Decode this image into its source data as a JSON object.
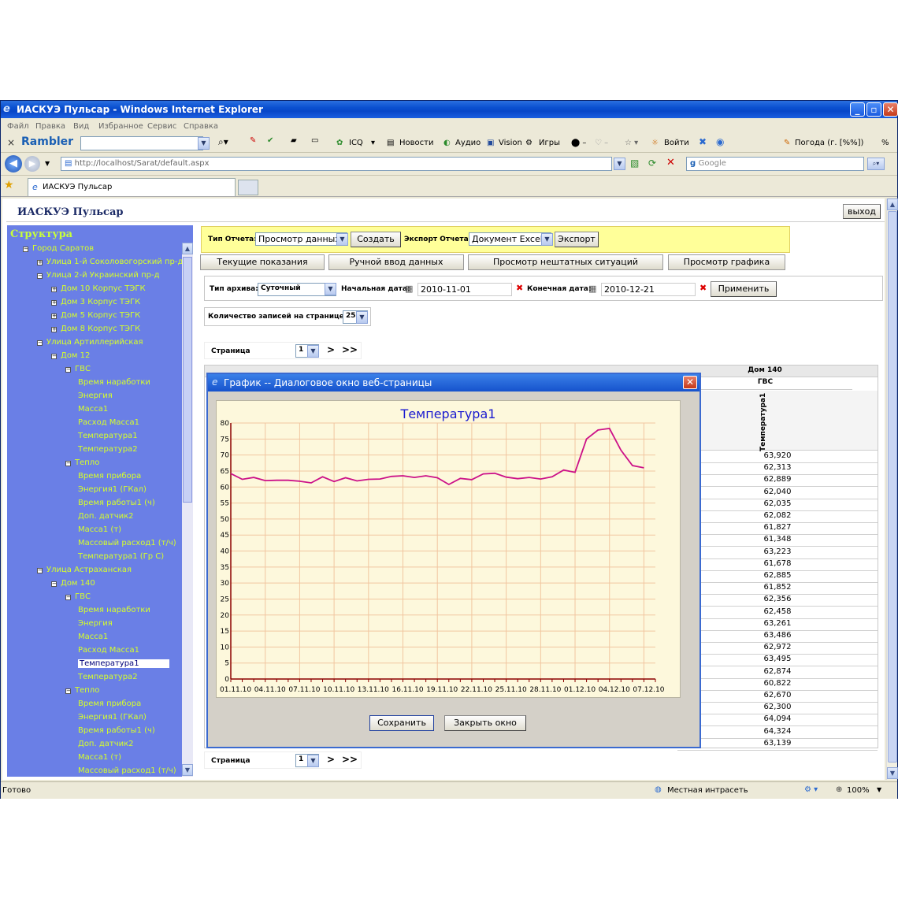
{
  "window": {
    "title": "ИАСКУЭ Пульсар - Windows Internet Explorer",
    "menu": [
      "Файл",
      "Правка",
      "Вид",
      "Избранное",
      "Сервис",
      "Справка"
    ]
  },
  "rambler_bar": {
    "close": "×",
    "brand": "Rambler",
    "items": [
      "ICQ",
      "Новости",
      "Аудио",
      "Vision",
      "Игры",
      "Войти"
    ],
    "weather": "Погода (г. [%%])",
    "percent": "%"
  },
  "address_bar": {
    "url": "http://localhost/Sarat/default.aspx",
    "search_placeholder": "Google"
  },
  "tab": {
    "label": "ИАСКУЭ Пульсар"
  },
  "app": {
    "title": "ИАСКУЭ Пульсар",
    "logout": "выход"
  },
  "tree": {
    "title": "Структура",
    "items": [
      {
        "label": "Город Саратов",
        "level": 1,
        "exp": "−"
      },
      {
        "label": "Улица 1-й Соколовогорский пр-д",
        "level": 2,
        "exp": "+"
      },
      {
        "label": "Улица 2-й Украинский пр-д",
        "level": 2,
        "exp": "−"
      },
      {
        "label": "Дом 10 Корпус ТЭГК",
        "level": 3,
        "exp": "+"
      },
      {
        "label": "Дом 3 Корпус ТЭГК",
        "level": 3,
        "exp": "+"
      },
      {
        "label": "Дом 5 Корпус ТЭГК",
        "level": 3,
        "exp": "+"
      },
      {
        "label": "Дом 8 Корпус ТЭГК",
        "level": 3,
        "exp": "+"
      },
      {
        "label": "Улица Артиллерийская",
        "level": 2,
        "exp": "−"
      },
      {
        "label": "Дом 12",
        "level": 3,
        "exp": "−"
      },
      {
        "label": "ГВС",
        "level": 4,
        "exp": "−"
      },
      {
        "label": "Время наработки",
        "level": 5
      },
      {
        "label": "Энергия",
        "level": 5
      },
      {
        "label": "Масса1",
        "level": 5
      },
      {
        "label": "Расход Масса1",
        "level": 5
      },
      {
        "label": "Температура1",
        "level": 5
      },
      {
        "label": "Температура2",
        "level": 5
      },
      {
        "label": "Тепло",
        "level": 4,
        "exp": "−"
      },
      {
        "label": "Время прибора",
        "level": 5
      },
      {
        "label": "Энергия1 (ГКал)",
        "level": 5
      },
      {
        "label": "Время работы1 (ч)",
        "level": 5
      },
      {
        "label": "Доп. датчик2",
        "level": 5
      },
      {
        "label": "Масса1 (т)",
        "level": 5
      },
      {
        "label": "Массовый расход1 (т/ч)",
        "level": 5
      },
      {
        "label": "Температура1 (Гр С)",
        "level": 5
      },
      {
        "label": "Улица Астраханская",
        "level": 2,
        "exp": "−"
      },
      {
        "label": "Дом 140",
        "level": 3,
        "exp": "−"
      },
      {
        "label": "ГВС",
        "level": 4,
        "exp": "−"
      },
      {
        "label": "Время наработки",
        "level": 5
      },
      {
        "label": "Энергия",
        "level": 5
      },
      {
        "label": "Масса1",
        "level": 5
      },
      {
        "label": "Расход Масса1",
        "level": 5
      },
      {
        "label": "Температура1",
        "level": 5,
        "selected": true
      },
      {
        "label": "Температура2",
        "level": 5
      },
      {
        "label": "Тепло",
        "level": 4,
        "exp": "−"
      },
      {
        "label": "Время прибора",
        "level": 5
      },
      {
        "label": "Энергия1 (ГКал)",
        "level": 5
      },
      {
        "label": "Время работы1 (ч)",
        "level": 5
      },
      {
        "label": "Доп. датчик2",
        "level": 5
      },
      {
        "label": "Масса1 (т)",
        "level": 5
      },
      {
        "label": "Массовый расход1 (т/ч)",
        "level": 5
      }
    ]
  },
  "report": {
    "type_label": "Тип Отчета:",
    "type_value": "Просмотр данных",
    "create": "Создать",
    "export_label": "Экспорт Отчета:",
    "export_value": "Документ Excel",
    "export_btn": "Экспорт"
  },
  "tabs": [
    "Текущие показания",
    "Ручной ввод данных",
    "Просмотр нештатных ситуаций",
    "Просмотр графика"
  ],
  "filter": {
    "archive_label": "Тип архива:",
    "archive_value": "Суточный",
    "start_label": "Начальная дата:",
    "start_value": "2010-11-01",
    "end_label": "Конечная дата:",
    "end_value": "2010-12-21",
    "apply": "Применить"
  },
  "records": {
    "label": "Количество записей на странице",
    "value": "25"
  },
  "pager": {
    "label": "Страница",
    "value": "1",
    "next": ">",
    "last": ">>"
  },
  "table": {
    "house": "Дом 140",
    "group": "ГВС",
    "column": "Температура1",
    "values": [
      "63,920",
      "62,313",
      "62,889",
      "62,040",
      "62,035",
      "62,082",
      "61,827",
      "61,348",
      "63,223",
      "61,678",
      "62,885",
      "61,852",
      "62,356",
      "62,458",
      "63,261",
      "63,486",
      "62,972",
      "63,495",
      "62,874",
      "60,822",
      "62,670",
      "62,300",
      "64,094",
      "64,324",
      "63,139"
    ]
  },
  "dialog": {
    "title": "График -- Диалоговое окно веб-страницы",
    "close": "✕",
    "save": "Сохранить",
    "close_window": "Закрыть окно"
  },
  "chart_data": {
    "type": "line",
    "title": "Температура1",
    "ylim": [
      0,
      80
    ],
    "yticks": [
      0,
      5,
      10,
      15,
      20,
      25,
      30,
      35,
      40,
      45,
      50,
      55,
      60,
      65,
      70,
      75,
      80
    ],
    "x_tick_labels": [
      "01.11.10",
      "04.11.10",
      "07.11.10",
      "10.11.10",
      "13.11.10",
      "16.11.10",
      "19.11.10",
      "22.11.10",
      "25.11.10",
      "28.11.10",
      "01.12.10",
      "04.12.10",
      "07.12.10"
    ],
    "x_count": 38,
    "series": [
      {
        "color": "#cc1188",
        "values": [
          64.2,
          62.4,
          63.0,
          62.0,
          62.1,
          62.1,
          61.8,
          61.3,
          63.2,
          61.7,
          62.9,
          61.9,
          62.4,
          62.5,
          63.3,
          63.5,
          63.0,
          63.5,
          62.9,
          60.8,
          62.7,
          62.3,
          64.1,
          64.3,
          63.1,
          62.6,
          63.0,
          62.5,
          63.2,
          65.3,
          64.6,
          75.0,
          77.8,
          78.3,
          71.5,
          66.7,
          66.0
        ]
      }
    ],
    "grid": true,
    "background": "#fdf8dc",
    "grid_color": "#f1c6a0",
    "axis_color": "#8b0000"
  },
  "status": {
    "left": "Готово",
    "zone": "Местная интрасеть",
    "zoom": "100%"
  },
  "colors": {
    "tree_bg": "#6a7fe6",
    "tree_text": "#d6ff2a",
    "report_bg": "#ffff99",
    "title_blue": "#1652cc"
  }
}
